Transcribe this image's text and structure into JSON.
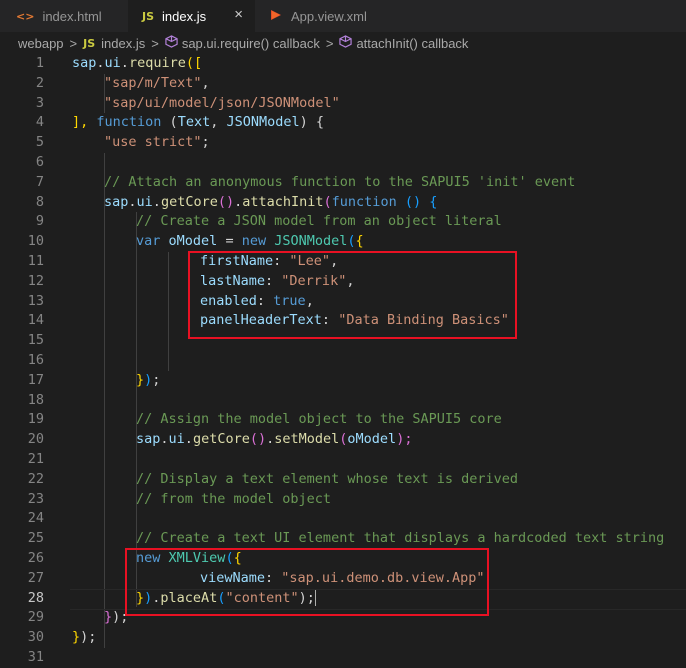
{
  "tabs": [
    {
      "icon": "<>",
      "label": "index.html",
      "active": false
    },
    {
      "icon": "JS",
      "label": "index.js",
      "active": true,
      "close": "×"
    },
    {
      "icon": "",
      "label": "App.view.xml",
      "active": false
    }
  ],
  "breadcrumb": {
    "folder": "webapp",
    "file_icon": "JS",
    "file": "index.js",
    "item1": "sap.ui.require() callback",
    "item2": "attachInit() callback",
    "separator": ">"
  },
  "editor": {
    "current_line": 28,
    "lines": [
      {
        "n": "1"
      },
      {
        "n": "2"
      },
      {
        "n": "3"
      },
      {
        "n": "4"
      },
      {
        "n": "5"
      },
      {
        "n": "6"
      },
      {
        "n": "7"
      },
      {
        "n": "8"
      },
      {
        "n": "9"
      },
      {
        "n": "10"
      },
      {
        "n": "11"
      },
      {
        "n": "12"
      },
      {
        "n": "13"
      },
      {
        "n": "14"
      },
      {
        "n": "15"
      },
      {
        "n": "16"
      },
      {
        "n": "17"
      },
      {
        "n": "18"
      },
      {
        "n": "19"
      },
      {
        "n": "20"
      },
      {
        "n": "21"
      },
      {
        "n": "22"
      },
      {
        "n": "23"
      },
      {
        "n": "24"
      },
      {
        "n": "25"
      },
      {
        "n": "26"
      },
      {
        "n": "27"
      },
      {
        "n": "28"
      },
      {
        "n": "29"
      },
      {
        "n": "30"
      },
      {
        "n": "31"
      }
    ],
    "code": {
      "l1": [
        "sap",
        ".",
        "ui",
        ".",
        "require",
        "(["
      ],
      "l2": "\"sap/m/Text\"",
      "l3": "\"sap/ui/model/json/JSONModel\"",
      "l4": [
        "], ",
        "function",
        " (",
        "Text",
        ", ",
        "JSONModel",
        ") {"
      ],
      "l5": "\"use strict\"",
      "l7": "// Attach an anonymous function to the SAPUI5 'init' event",
      "l8": [
        "sap",
        ".",
        "ui",
        ".",
        "getCore",
        "()",
        ".",
        "attachInit",
        "(",
        "function",
        " () ",
        "{"
      ],
      "l9": "// Create a JSON model from an object literal",
      "l10": [
        "var",
        " ",
        "oModel",
        " = ",
        "new",
        " ",
        "JSONModel",
        "(",
        "{"
      ],
      "l11": [
        "firstName",
        ": ",
        "\"Lee\"",
        ","
      ],
      "l12": [
        "lastName",
        ": ",
        "\"Derrik\"",
        ","
      ],
      "l13": [
        "enabled",
        ": ",
        "true",
        ","
      ],
      "l14": [
        "panelHeaderText",
        ": ",
        "\"Data Binding Basics\""
      ],
      "l17": [
        "}",
        ")",
        ";"
      ],
      "l19": "// Assign the model object to the SAPUI5 core",
      "l20": [
        "sap",
        ".",
        "ui",
        ".",
        "getCore",
        "()",
        ".",
        "setModel",
        "(",
        "oModel",
        ");"
      ],
      "l22": "// Display a text element whose text is derived",
      "l23": "// from the model object",
      "l25": "// Create a text UI element that displays a hardcoded text string",
      "l26": [
        "new",
        " ",
        "XMLView",
        "(",
        "{"
      ],
      "l27": [
        "viewName",
        ": ",
        "\"sap.ui.demo.db.view.App\""
      ],
      "l28": [
        "}",
        ")",
        ".",
        "placeAt",
        "(",
        "\"content\"",
        ");"
      ],
      "l29": [
        "}",
        ");"
      ],
      "l30": [
        "}",
        ");"
      ],
      "semicolon": ";",
      "comma": ","
    }
  },
  "colors": {
    "keyword": "#569cd6",
    "string": "#ce9178",
    "comment": "#6a9955",
    "variable": "#9cdcfe",
    "function": "#dcdcaa",
    "type": "#4ec9b0",
    "highlight_box": "#e81123"
  }
}
